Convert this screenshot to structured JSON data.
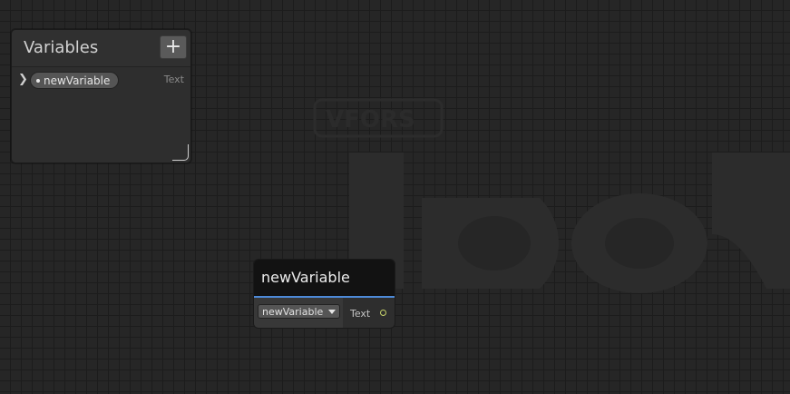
{
  "blackboard": {
    "title": "Variables",
    "add_label": "+",
    "variables": [
      {
        "name": "newVariable",
        "type": "Text"
      }
    ]
  },
  "node": {
    "title": "newVariable",
    "selected_variable": "newVariable",
    "output_label": "Text",
    "accent_color": "#4d8ad8",
    "port_color": "#c7d36b"
  },
  "watermark": {
    "label": "VFORS"
  },
  "icons": {
    "expand": "chevron-right-icon",
    "add": "plus-icon",
    "dropdown": "caret-down-icon",
    "port": "output-port-icon"
  }
}
